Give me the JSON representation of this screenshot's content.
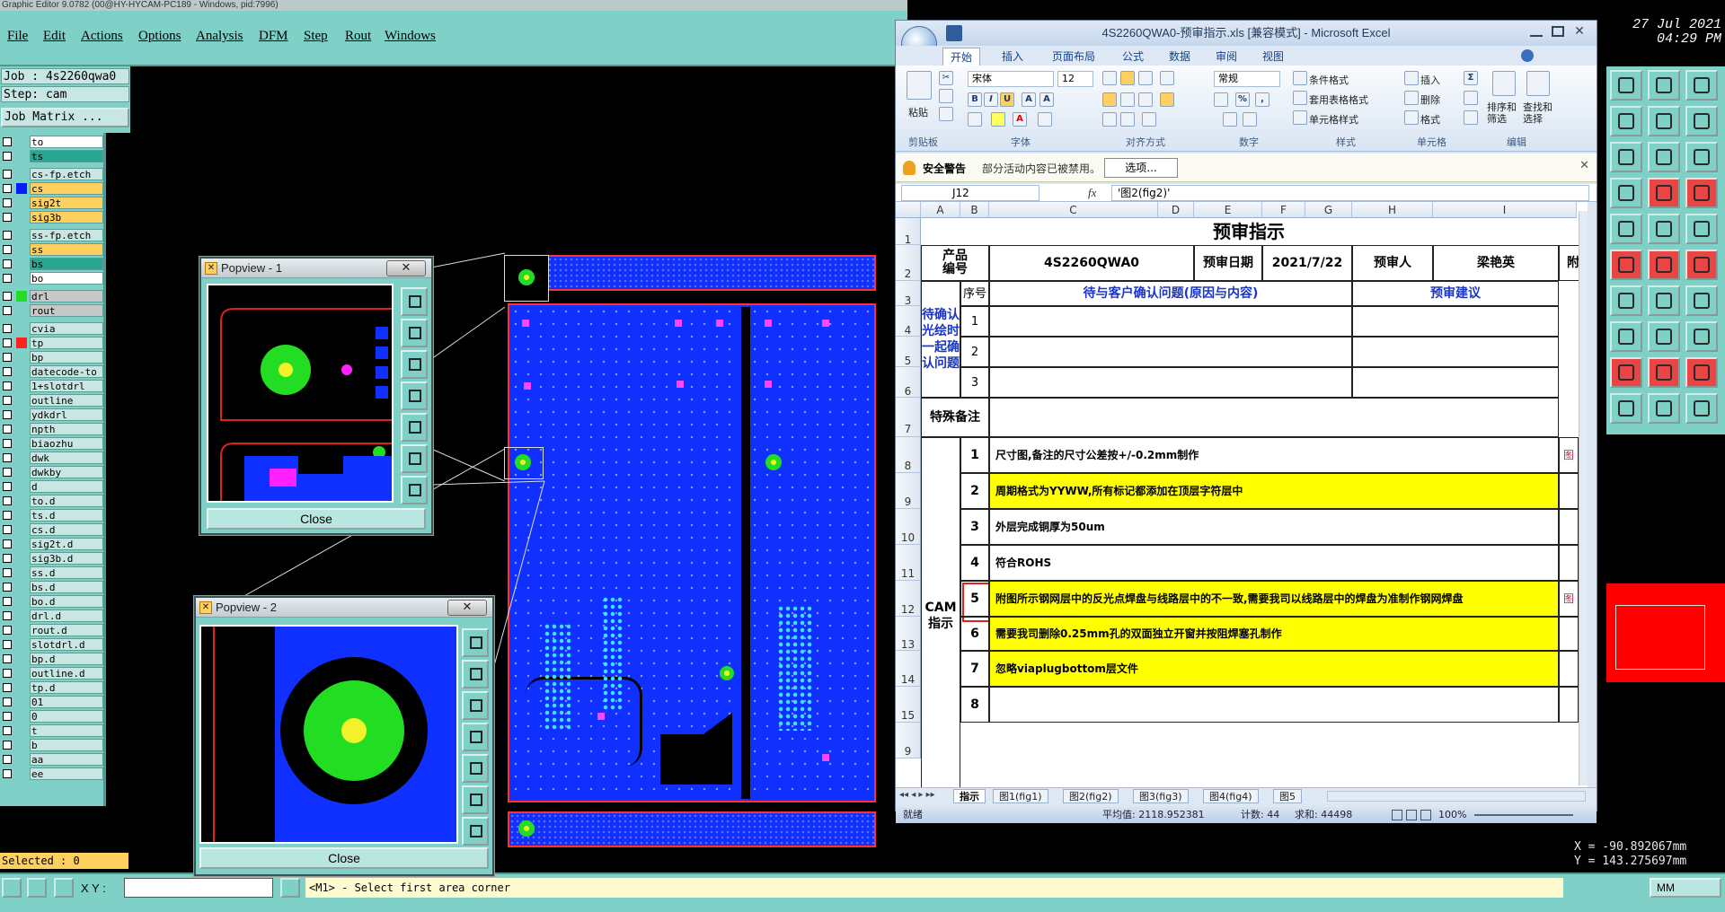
{
  "app": {
    "title": "Graphic Editor 9.0782 (00@HY-HYCAM-PC189 - Windows, pid:7996)",
    "menu": [
      "File",
      "Edit",
      "Actions",
      "Options",
      "Analysis",
      "DFM",
      "Step",
      "Rout",
      "Windows"
    ],
    "job_label": "Job : 4s2260qwa0",
    "step_label": "Step: cam",
    "job_matrix": "Job Matrix ...",
    "datetime": {
      "date": "27 Jul 2021",
      "time": "04:29 PM",
      "prefix": "00"
    },
    "selected": "Selected : 0",
    "coords": {
      "x": "X = -90.892067mm",
      "y": "Y = 143.275697mm"
    },
    "status_prompt": "<M1> - Select first area corner",
    "xy_label": "X Y :",
    "units": "MM",
    "layers": [
      {
        "name": "to",
        "color": "#ffffff",
        "swatch": ""
      },
      {
        "name": "ts",
        "color": "#2aa58f",
        "swatch": ""
      },
      {
        "name": "cs-fp.etch",
        "color": "#c8e6e2",
        "swatch": ""
      },
      {
        "name": "cs",
        "color": "#ffd060",
        "swatch": "#0a1cff"
      },
      {
        "name": "sig2t",
        "color": "#ffd060",
        "swatch": ""
      },
      {
        "name": "sig3b",
        "color": "#ffd060",
        "swatch": ""
      },
      {
        "name": "ss-fp.etch",
        "color": "#c8e6e2",
        "swatch": ""
      },
      {
        "name": "ss",
        "color": "#ffd060",
        "swatch": ""
      },
      {
        "name": "bs",
        "color": "#2aa58f",
        "swatch": ""
      },
      {
        "name": "bo",
        "color": "#ffffff",
        "swatch": ""
      },
      {
        "name": "drl",
        "color": "#c8c8c8",
        "swatch": "#22dd22"
      },
      {
        "name": "rout",
        "color": "#c8c8c8",
        "swatch": ""
      },
      {
        "name": "cvia",
        "color": "#c8e6e2",
        "swatch": ""
      },
      {
        "name": "tp",
        "color": "#c8e6e2",
        "swatch": "#ff2020"
      },
      {
        "name": "bp",
        "color": "#c8e6e2",
        "swatch": ""
      },
      {
        "name": "datecode-to",
        "color": "#c8e6e2",
        "swatch": ""
      },
      {
        "name": "1+slotdrl",
        "color": "#c8e6e2",
        "swatch": ""
      },
      {
        "name": "outline",
        "color": "#c8e6e2",
        "swatch": ""
      },
      {
        "name": "ydkdrl",
        "color": "#c8e6e2",
        "swatch": ""
      },
      {
        "name": "npth",
        "color": "#c8e6e2",
        "swatch": ""
      },
      {
        "name": "biaozhu",
        "color": "#c8e6e2",
        "swatch": ""
      },
      {
        "name": "dwk",
        "color": "#c8e6e2",
        "swatch": ""
      },
      {
        "name": "dwkby",
        "color": "#c8e6e2",
        "swatch": ""
      },
      {
        "name": "d",
        "color": "#c8e6e2",
        "swatch": ""
      },
      {
        "name": "to.d",
        "color": "#c8e6e2",
        "swatch": ""
      },
      {
        "name": "ts.d",
        "color": "#c8e6e2",
        "swatch": ""
      },
      {
        "name": "cs.d",
        "color": "#c8e6e2",
        "swatch": ""
      },
      {
        "name": "sig2t.d",
        "color": "#c8e6e2",
        "swatch": ""
      },
      {
        "name": "sig3b.d",
        "color": "#c8e6e2",
        "swatch": ""
      },
      {
        "name": "ss.d",
        "color": "#c8e6e2",
        "swatch": ""
      },
      {
        "name": "bs.d",
        "color": "#c8e6e2",
        "swatch": ""
      },
      {
        "name": "bo.d",
        "color": "#c8e6e2",
        "swatch": ""
      },
      {
        "name": "drl.d",
        "color": "#c8e6e2",
        "swatch": ""
      },
      {
        "name": "rout.d",
        "color": "#c8e6e2",
        "swatch": ""
      },
      {
        "name": "slotdrl.d",
        "color": "#c8e6e2",
        "swatch": ""
      },
      {
        "name": "bp.d",
        "color": "#c8e6e2",
        "swatch": ""
      },
      {
        "name": "outline.d",
        "color": "#c8e6e2",
        "swatch": ""
      },
      {
        "name": "tp.d",
        "color": "#c8e6e2",
        "swatch": ""
      },
      {
        "name": "01",
        "color": "#c8e6e2",
        "swatch": ""
      },
      {
        "name": "0",
        "color": "#c8e6e2",
        "swatch": ""
      },
      {
        "name": "t",
        "color": "#c8e6e2",
        "swatch": ""
      },
      {
        "name": "b",
        "color": "#c8e6e2",
        "swatch": ""
      },
      {
        "name": "aa",
        "color": "#c8e6e2",
        "swatch": ""
      },
      {
        "name": "ee",
        "color": "#c8e6e2",
        "swatch": ""
      }
    ],
    "popview1": {
      "title": "Popview - 1",
      "close": "Close"
    },
    "popview2": {
      "title": "Popview - 2",
      "close": "Close"
    }
  },
  "excel": {
    "title": "4S2260QWA0-预审指示.xls  [兼容模式]  - Microsoft Excel",
    "tabs": [
      "开始",
      "插入",
      "页面布局",
      "公式",
      "数据",
      "审阅",
      "视图"
    ],
    "ribbon": {
      "paste": "粘贴",
      "clipboard": "剪贴板",
      "font_name": "宋体",
      "font_size": "12",
      "font_group": "字体",
      "align_group": "对齐方式",
      "number_format": "常规",
      "number_group": "数字",
      "cond_format": "条件格式",
      "table_format": "套用表格格式",
      "cell_style": "单元格样式",
      "style_group": "样式",
      "insert": "插入",
      "delete": "删除",
      "format": "格式",
      "cells_group": "单元格",
      "sort": "排序和\n筛选",
      "find": "查找和\n选择",
      "edit_group": "编辑"
    },
    "security": {
      "title": "安全警告",
      "message": "部分活动内容已被禁用。",
      "button": "选项..."
    },
    "namebox": "J12",
    "formula": "'图2(fig2)'",
    "columns": [
      "A",
      "B",
      "C",
      "D",
      "E",
      "F",
      "G",
      "H",
      "I"
    ],
    "rows": [
      "1",
      "2",
      "3",
      "4",
      "5",
      "6",
      "7",
      "8",
      "9",
      "10",
      "11",
      "12",
      "13",
      "14",
      "15",
      "9"
    ],
    "sheet": {
      "heading": "预审指示",
      "product_label": "产品\n编号",
      "product_no": "4S2260QWA0",
      "review_date_label": "预审日期",
      "review_date": "2021/7/22",
      "reviewer_label": "预审人",
      "reviewer": "梁艳英",
      "attach": "附",
      "pending_label": "待确认\n光绘时\n一起确\n认问题",
      "seq": "序号",
      "issue_head": "待与客户确认问题(原因与内容)",
      "suggest_head": "预审建议",
      "special": "特殊备注",
      "cam_label": "CAM\n指示",
      "fig": "图",
      "items": [
        {
          "n": "1",
          "text": "尺寸图,备注的尺寸公差按+/-0.2mm制作",
          "hl": false
        },
        {
          "n": "2",
          "text": "周期格式为YYWW,所有标记都添加在顶层字符层中",
          "hl": true
        },
        {
          "n": "3",
          "text": "外层完成铜厚为50um",
          "hl": false
        },
        {
          "n": "4",
          "text": "符合ROHS",
          "hl": false
        },
        {
          "n": "5",
          "text": "附图所示钢网层中的反光点焊盘与线路层中的不一致,需要我司以线路层中的焊盘为准制作钢网焊盘",
          "hl": true
        },
        {
          "n": "6",
          "text": "需要我司删除0.25mm孔的双面独立开窗并按阻焊塞孔制作",
          "hl": true
        },
        {
          "n": "7",
          "text": "忽略viaplugbottom层文件",
          "hl": true
        },
        {
          "n": "8",
          "text": "",
          "hl": false
        }
      ]
    },
    "sheet_tabs": [
      "指示",
      "图1(fig1)",
      "图2(fig2)",
      "图3(fig3)",
      "图4(fig4)",
      "图5"
    ],
    "status": {
      "ready": "就绪",
      "average": "平均值: 2118.952381",
      "count": "计数: 44",
      "sum": "求和: 44498",
      "zoom": "100%"
    }
  }
}
